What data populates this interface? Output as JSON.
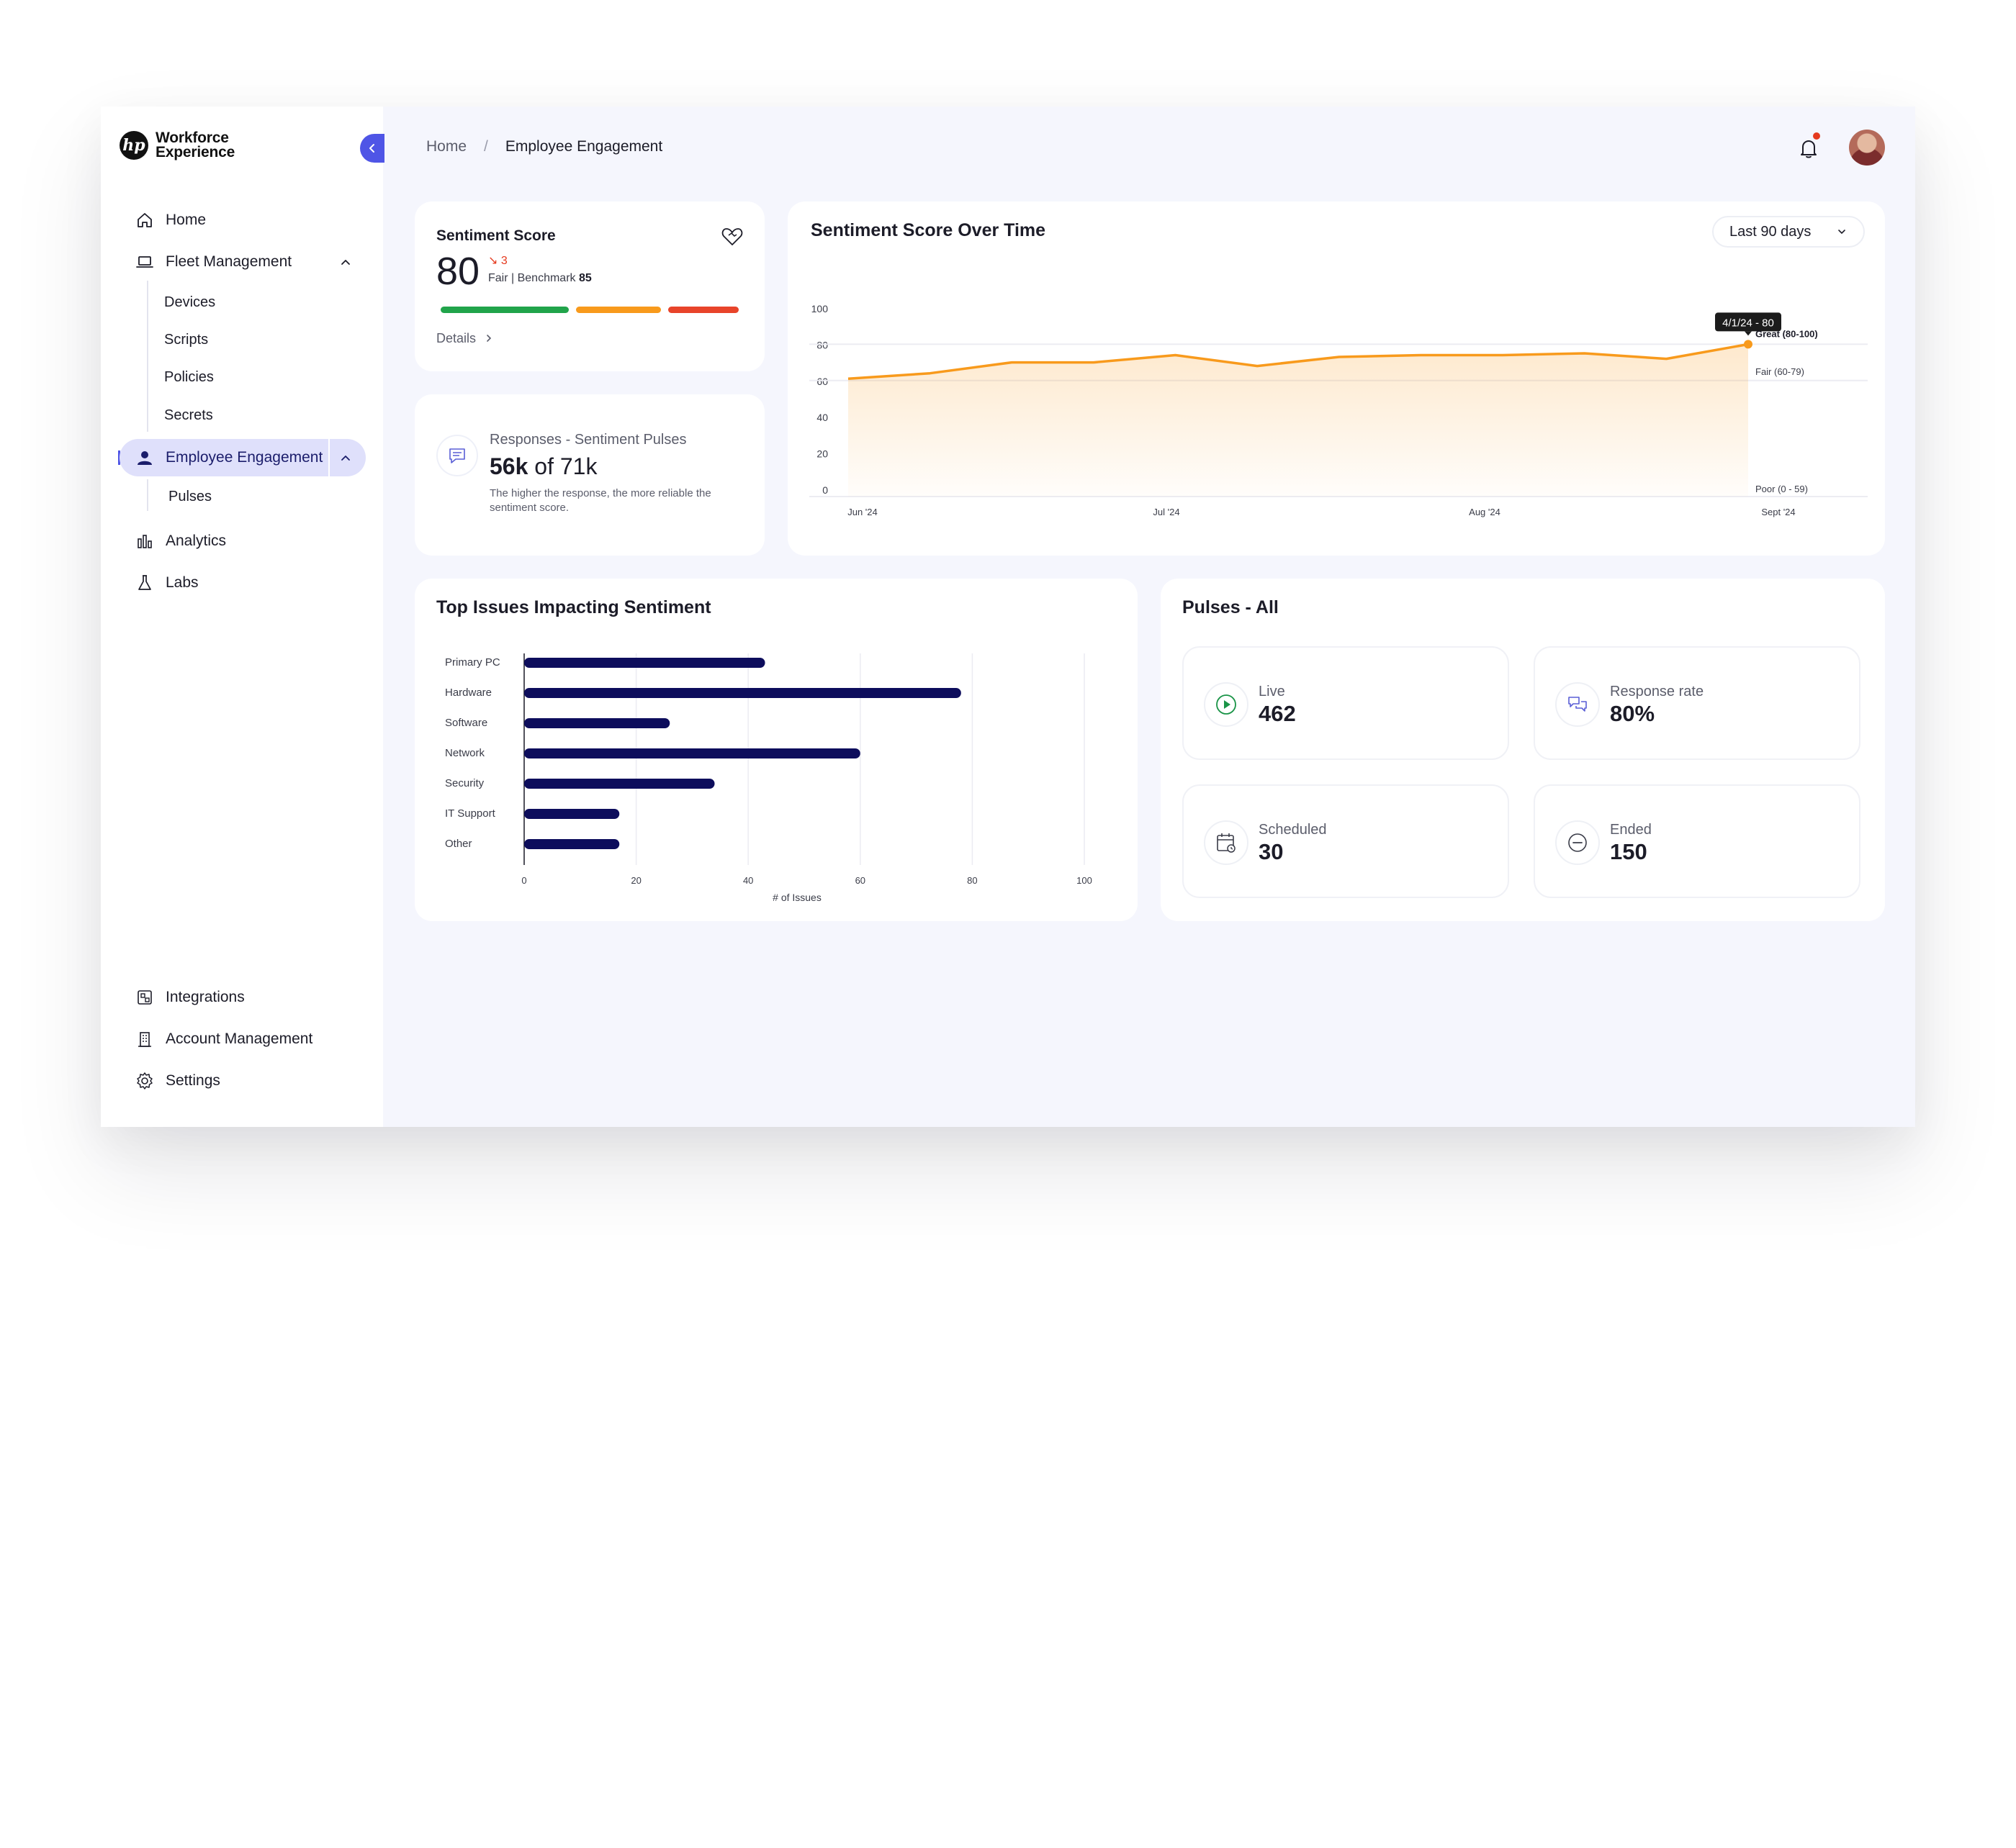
{
  "app": {
    "logo_text_line1": "Workforce",
    "logo_text_line2": "Experience",
    "logo_mark": "hp"
  },
  "sidebar": {
    "items": [
      {
        "label": "Home",
        "icon": "home-icon"
      },
      {
        "label": "Fleet Management",
        "icon": "laptop-icon"
      },
      {
        "label": "Employee Engagement",
        "icon": "user-icon"
      },
      {
        "label": "Analytics",
        "icon": "bar-chart-icon"
      },
      {
        "label": "Labs",
        "icon": "flask-icon"
      }
    ],
    "fleet_sub": [
      "Devices",
      "Scripts",
      "Policies",
      "Secrets"
    ],
    "engagement_sub": [
      "Pulses"
    ],
    "bottom": [
      {
        "label": "Integrations",
        "icon": "integrations-icon"
      },
      {
        "label": "Account Management",
        "icon": "building-icon"
      },
      {
        "label": "Settings",
        "icon": "gear-icon"
      }
    ]
  },
  "header": {
    "breadcrumb": [
      "Home",
      "/",
      "Employee Engagement"
    ]
  },
  "sentiment": {
    "title": "Sentiment Score",
    "value": "80",
    "delta": "↘ 3",
    "fair_label": "Fair | Benchmark",
    "benchmark": "85",
    "details": "Details",
    "bar_colors": [
      "#21a44b",
      "#f89a1c",
      "#e8442a"
    ]
  },
  "responses": {
    "title": "Responses - Sentiment Pulses",
    "value": "56k",
    "of_text": "of 71k",
    "desc": "The higher the response, the more reliable the sentiment score."
  },
  "over_time": {
    "title": "Sentiment Score Over Time",
    "range_select": "Last 90 days",
    "tooltip": "4/1/24 - 80",
    "band_labels": [
      "Great (80-100)",
      "Fair (60-79)",
      "Poor (0 - 59)"
    ]
  },
  "issues": {
    "title": "Top Issues Impacting Sentiment"
  },
  "pulses": {
    "title": "Pulses - All",
    "tiles": [
      {
        "label": "Live",
        "value": "462",
        "icon": "play-icon"
      },
      {
        "label": "Response rate",
        "value": "80%",
        "icon": "chat-icon"
      },
      {
        "label": "Scheduled",
        "value": "30",
        "icon": "calendar-icon"
      },
      {
        "label": "Ended",
        "value": "150",
        "icon": "minus-circle-icon"
      }
    ]
  },
  "chart_data": [
    {
      "type": "area",
      "title": "Sentiment Score Over Time",
      "x_ticks": [
        "Jun '24",
        "Jul '24",
        "Aug '24",
        "Sept '24"
      ],
      "ylim": [
        0,
        100
      ],
      "y_ticks": [
        0,
        20,
        40,
        60,
        80,
        100
      ],
      "values": [
        61,
        64,
        70,
        70,
        74,
        68,
        73,
        74,
        74,
        75,
        72,
        80
      ],
      "line_color": "#f89a1c",
      "grid": true
    },
    {
      "type": "bar",
      "orientation": "horizontal",
      "title": "Top Issues Impacting Sentiment",
      "categories": [
        "Primary PC",
        "Hardware",
        "Software",
        "Network",
        "Security",
        "IT Support",
        "Other"
      ],
      "values": [
        43,
        78,
        26,
        60,
        34,
        17,
        17
      ],
      "xlabel": "# of Issues",
      "xlim": [
        0,
        100
      ],
      "x_ticks": [
        0,
        20,
        40,
        60,
        80,
        100
      ],
      "bar_color": "#0d0d5c"
    }
  ]
}
